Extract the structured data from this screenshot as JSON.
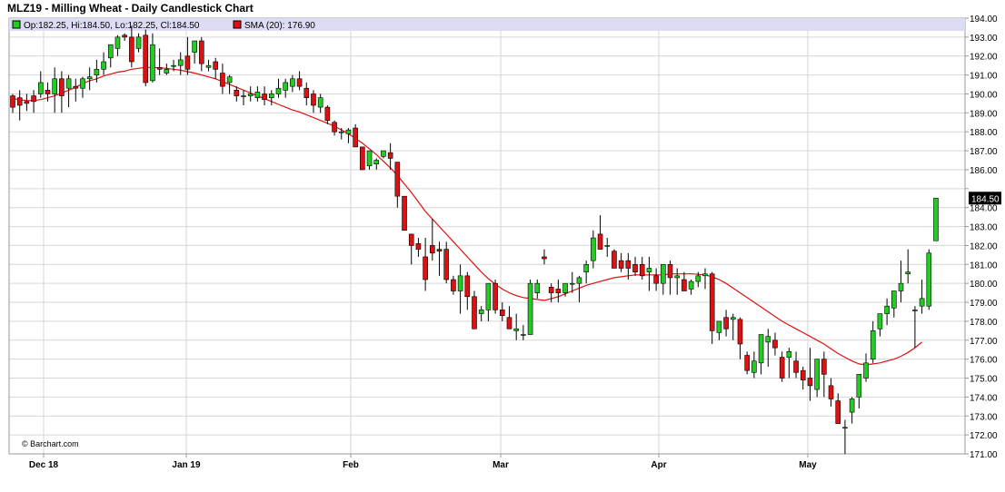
{
  "title": "MLZ19 - Milling Wheat - Daily Candlestick Chart",
  "legend": {
    "ohlc": "Op:182.25, Hi:184.50, Lo:182.25, Cl:184.50",
    "sma": "SMA (20): 176.90"
  },
  "copyright": "© Barchart.com",
  "last_price": "184.50",
  "colors": {
    "up": "#22cc22",
    "down": "#dd1111",
    "sma": "#dd1111",
    "grid": "#d6d6d6",
    "legend_bg": "#dcdcf4"
  },
  "chart_data": {
    "type": "candlestick",
    "y_range": [
      171,
      194
    ],
    "y_ticks": [
      "171.00",
      "172.00",
      "173.00",
      "174.00",
      "175.00",
      "176.00",
      "177.00",
      "178.00",
      "179.00",
      "180.00",
      "181.00",
      "182.00",
      "183.00",
      "184.00",
      "185.00",
      "186.00",
      "187.00",
      "188.00",
      "189.00",
      "190.00",
      "191.00",
      "192.00",
      "193.00",
      "194.00"
    ],
    "date_labels": [
      "Dec 18",
      "Jan 19",
      "Feb",
      "Mar",
      "Apr",
      "May"
    ],
    "grid": true,
    "series": [
      {
        "name": "Milling Wheat",
        "candles": [
          [
            189.9,
            190.0,
            189.0,
            189.3
          ],
          [
            189.8,
            190.2,
            188.6,
            189.4
          ],
          [
            189.6,
            190.0,
            189.1,
            189.5
          ],
          [
            189.9,
            190.2,
            189.0,
            189.6
          ],
          [
            190.0,
            191.2,
            189.8,
            190.6
          ],
          [
            190.2,
            190.6,
            189.6,
            190.0
          ],
          [
            190.0,
            191.4,
            189.0,
            190.8
          ],
          [
            190.8,
            191.2,
            189.0,
            189.9
          ],
          [
            190.3,
            191.0,
            189.3,
            190.8
          ],
          [
            190.4,
            190.8,
            189.6,
            190.3
          ],
          [
            190.3,
            190.9,
            189.8,
            190.8
          ],
          [
            190.8,
            191.4,
            190.2,
            190.9
          ],
          [
            191.0,
            191.8,
            190.6,
            191.3
          ],
          [
            191.3,
            192.2,
            191.0,
            191.7
          ],
          [
            191.9,
            192.6,
            191.4,
            192.6
          ],
          [
            192.4,
            193.1,
            192.0,
            193.0
          ],
          [
            193.1,
            193.2,
            192.8,
            193.0
          ],
          [
            193.0,
            193.6,
            191.4,
            191.7
          ],
          [
            192.4,
            193.2,
            192.2,
            193.0
          ],
          [
            193.1,
            193.4,
            190.4,
            190.6
          ],
          [
            190.7,
            193.2,
            190.6,
            192.6
          ],
          [
            191.4,
            192.4,
            191.0,
            191.3
          ],
          [
            191.1,
            191.6,
            191.0,
            191.3
          ],
          [
            191.5,
            191.8,
            191.2,
            191.5
          ],
          [
            191.5,
            192.2,
            191.0,
            191.8
          ],
          [
            192.0,
            193.0,
            191.0,
            191.3
          ],
          [
            192.2,
            192.8,
            191.6,
            192.8
          ],
          [
            192.8,
            193.0,
            191.2,
            191.6
          ],
          [
            191.4,
            191.8,
            191.2,
            191.5
          ],
          [
            191.7,
            191.9,
            190.8,
            191.3
          ],
          [
            191.1,
            191.6,
            190.0,
            190.4
          ],
          [
            190.6,
            191.0,
            190.0,
            190.9
          ],
          [
            190.2,
            190.4,
            189.6,
            189.9
          ],
          [
            189.9,
            190.2,
            189.4,
            189.9
          ],
          [
            189.9,
            190.4,
            189.6,
            190.0
          ],
          [
            189.8,
            190.4,
            189.6,
            190.1
          ],
          [
            190.0,
            190.4,
            189.4,
            189.7
          ],
          [
            189.8,
            190.2,
            189.4,
            190.0
          ],
          [
            190.0,
            190.8,
            189.8,
            190.3
          ],
          [
            190.2,
            190.8,
            189.8,
            190.6
          ],
          [
            190.4,
            191.0,
            190.1,
            190.8
          ],
          [
            190.8,
            191.2,
            190.2,
            190.4
          ],
          [
            190.3,
            190.6,
            189.4,
            189.8
          ],
          [
            190.0,
            190.2,
            189.0,
            189.4
          ],
          [
            189.3,
            190.0,
            189.0,
            189.8
          ],
          [
            189.3,
            189.4,
            188.4,
            188.6
          ],
          [
            188.5,
            188.6,
            187.8,
            188.0
          ],
          [
            188.0,
            188.2,
            187.6,
            188.0
          ],
          [
            187.9,
            188.2,
            187.4,
            188.1
          ],
          [
            188.2,
            188.4,
            187.2,
            187.2
          ],
          [
            187.2,
            187.2,
            186.0,
            186.0
          ],
          [
            186.2,
            187.0,
            186.0,
            187.0
          ],
          [
            186.3,
            186.6,
            186.0,
            186.5
          ],
          [
            186.7,
            187.0,
            186.6,
            187.0
          ],
          [
            186.9,
            187.4,
            186.0,
            186.6
          ],
          [
            186.4,
            186.4,
            184.0,
            184.6
          ],
          [
            184.6,
            184.6,
            182.8,
            182.8
          ],
          [
            182.6,
            182.6,
            181.0,
            182.0
          ],
          [
            182.1,
            182.4,
            181.4,
            181.8
          ],
          [
            181.4,
            182.4,
            179.6,
            180.2
          ],
          [
            182.0,
            183.4,
            181.2,
            181.6
          ],
          [
            181.8,
            182.2,
            180.4,
            181.7
          ],
          [
            181.8,
            182.2,
            180.0,
            180.2
          ],
          [
            180.2,
            180.4,
            179.4,
            179.6
          ],
          [
            179.6,
            181.0,
            178.4,
            180.4
          ],
          [
            180.4,
            180.6,
            178.6,
            179.3
          ],
          [
            179.3,
            179.6,
            177.6,
            177.6
          ],
          [
            178.4,
            178.8,
            178.0,
            178.6
          ],
          [
            178.6,
            180.0,
            178.0,
            180.0
          ],
          [
            180.0,
            180.2,
            178.4,
            178.6
          ],
          [
            178.6,
            179.0,
            178.0,
            178.3
          ],
          [
            178.2,
            178.8,
            177.6,
            177.6
          ],
          [
            177.5,
            178.4,
            177.0,
            177.6
          ],
          [
            177.3,
            177.8,
            177.0,
            177.3
          ],
          [
            177.3,
            180.2,
            177.3,
            180.0
          ],
          [
            179.5,
            180.2,
            179.2,
            180.0
          ],
          [
            181.4,
            181.8,
            181.0,
            181.3
          ],
          [
            179.8,
            180.0,
            179.0,
            179.5
          ],
          [
            179.7,
            180.2,
            179.0,
            179.5
          ],
          [
            179.5,
            180.0,
            179.3,
            180.0
          ],
          [
            180.0,
            180.6,
            179.5,
            180.0
          ],
          [
            180.0,
            180.4,
            179.0,
            180.3
          ],
          [
            180.6,
            181.2,
            180.0,
            181.0
          ],
          [
            181.2,
            182.8,
            180.8,
            182.4
          ],
          [
            182.6,
            183.6,
            182.0,
            181.8
          ],
          [
            182.0,
            182.4,
            181.4,
            182.0
          ],
          [
            181.7,
            181.8,
            180.8,
            180.8
          ],
          [
            181.2,
            181.6,
            180.6,
            180.8
          ],
          [
            181.2,
            181.6,
            180.2,
            180.8
          ],
          [
            181.0,
            181.4,
            180.4,
            180.6
          ],
          [
            181.0,
            181.4,
            180.2,
            180.4
          ],
          [
            180.6,
            181.4,
            179.6,
            180.8
          ],
          [
            180.4,
            180.8,
            179.6,
            180.0
          ],
          [
            180.0,
            180.8,
            179.4,
            181.0
          ],
          [
            181.0,
            181.2,
            179.4,
            180.3
          ],
          [
            180.3,
            180.8,
            179.4,
            180.4
          ],
          [
            180.2,
            180.6,
            179.6,
            179.6
          ],
          [
            179.7,
            180.2,
            179.4,
            180.1
          ],
          [
            180.1,
            180.6,
            179.8,
            180.4
          ],
          [
            180.4,
            180.8,
            179.7,
            180.5
          ],
          [
            180.5,
            180.6,
            176.8,
            177.5
          ],
          [
            177.4,
            178.0,
            177.0,
            178.0
          ],
          [
            178.2,
            178.6,
            177.2,
            177.6
          ],
          [
            178.1,
            178.4,
            177.0,
            178.2
          ],
          [
            178.1,
            178.2,
            176.0,
            176.8
          ],
          [
            176.2,
            176.4,
            175.2,
            175.4
          ],
          [
            175.3,
            176.4,
            175.0,
            175.9
          ],
          [
            175.8,
            177.0,
            175.2,
            177.3
          ],
          [
            176.9,
            177.6,
            175.6,
            177.2
          ],
          [
            177.0,
            177.4,
            176.2,
            176.6
          ],
          [
            176.1,
            176.4,
            174.8,
            175.0
          ],
          [
            176.1,
            176.6,
            175.0,
            176.4
          ],
          [
            175.9,
            176.4,
            175.0,
            175.3
          ],
          [
            175.4,
            175.6,
            174.4,
            174.9
          ],
          [
            175.0,
            176.6,
            173.8,
            174.6
          ],
          [
            174.4,
            176.0,
            174.0,
            176.0
          ],
          [
            176.0,
            176.4,
            174.0,
            175.2
          ],
          [
            174.6,
            175.0,
            173.5,
            173.9
          ],
          [
            173.8,
            174.2,
            172.8,
            172.6
          ],
          [
            172.4,
            172.8,
            171.0,
            172.4
          ],
          [
            173.2,
            174.0,
            172.6,
            173.9
          ],
          [
            174.0,
            175.2,
            173.4,
            175.2
          ],
          [
            175.0,
            176.3,
            174.8,
            175.8
          ],
          [
            176.0,
            178.0,
            175.8,
            177.5
          ],
          [
            177.6,
            178.3,
            177.2,
            178.4
          ],
          [
            178.4,
            179.2,
            177.8,
            178.8
          ],
          [
            178.7,
            179.6,
            178.2,
            179.6
          ],
          [
            179.6,
            181.2,
            179.0,
            180.0
          ],
          [
            180.5,
            181.8,
            180.0,
            180.6
          ],
          [
            178.6,
            178.8,
            176.6,
            178.6
          ],
          [
            178.8,
            180.2,
            178.4,
            179.2
          ],
          [
            178.8,
            181.8,
            178.6,
            181.6
          ],
          [
            182.25,
            184.5,
            182.25,
            184.5
          ]
        ]
      },
      {
        "name": "SMA (20)",
        "values": [
          189.75,
          189.7,
          189.65,
          189.65,
          189.7,
          189.8,
          189.9,
          190.05,
          190.2,
          190.35,
          190.55,
          190.7,
          190.8,
          190.95,
          191.05,
          191.15,
          191.2,
          191.3,
          191.35,
          191.4,
          191.4,
          191.38,
          191.35,
          191.3,
          191.25,
          191.18,
          191.1,
          191.0,
          190.9,
          190.8,
          190.65,
          190.5,
          190.35,
          190.2,
          190.05,
          189.9,
          189.75,
          189.6,
          189.45,
          189.3,
          189.15,
          189.05,
          188.9,
          188.75,
          188.6,
          188.45,
          188.3,
          188.1,
          187.9,
          187.65,
          187.4,
          187.1,
          186.8,
          186.45,
          186.1,
          185.7,
          185.25,
          184.8,
          184.3,
          183.8,
          183.4,
          183.0,
          182.6,
          182.2,
          181.8,
          181.4,
          181.0,
          180.6,
          180.25,
          179.95,
          179.7,
          179.5,
          179.35,
          179.25,
          179.2,
          179.15,
          179.1,
          179.2,
          179.3,
          179.45,
          179.6,
          179.75,
          179.9,
          180.0,
          180.1,
          180.2,
          180.3,
          180.35,
          180.4,
          180.45,
          180.45,
          180.45,
          180.45,
          180.45,
          180.5,
          180.5,
          180.5,
          180.5,
          180.48,
          180.45,
          180.35,
          180.2,
          180.0,
          179.75,
          179.5,
          179.25,
          179.0,
          178.75,
          178.5,
          178.25,
          178.0,
          177.8,
          177.6,
          177.4,
          177.2,
          177.0,
          176.8,
          176.55,
          176.3,
          176.1,
          175.9,
          175.75,
          175.7,
          175.75,
          175.8,
          175.9,
          176.0,
          176.15,
          176.35,
          176.6,
          176.9
        ]
      }
    ]
  }
}
